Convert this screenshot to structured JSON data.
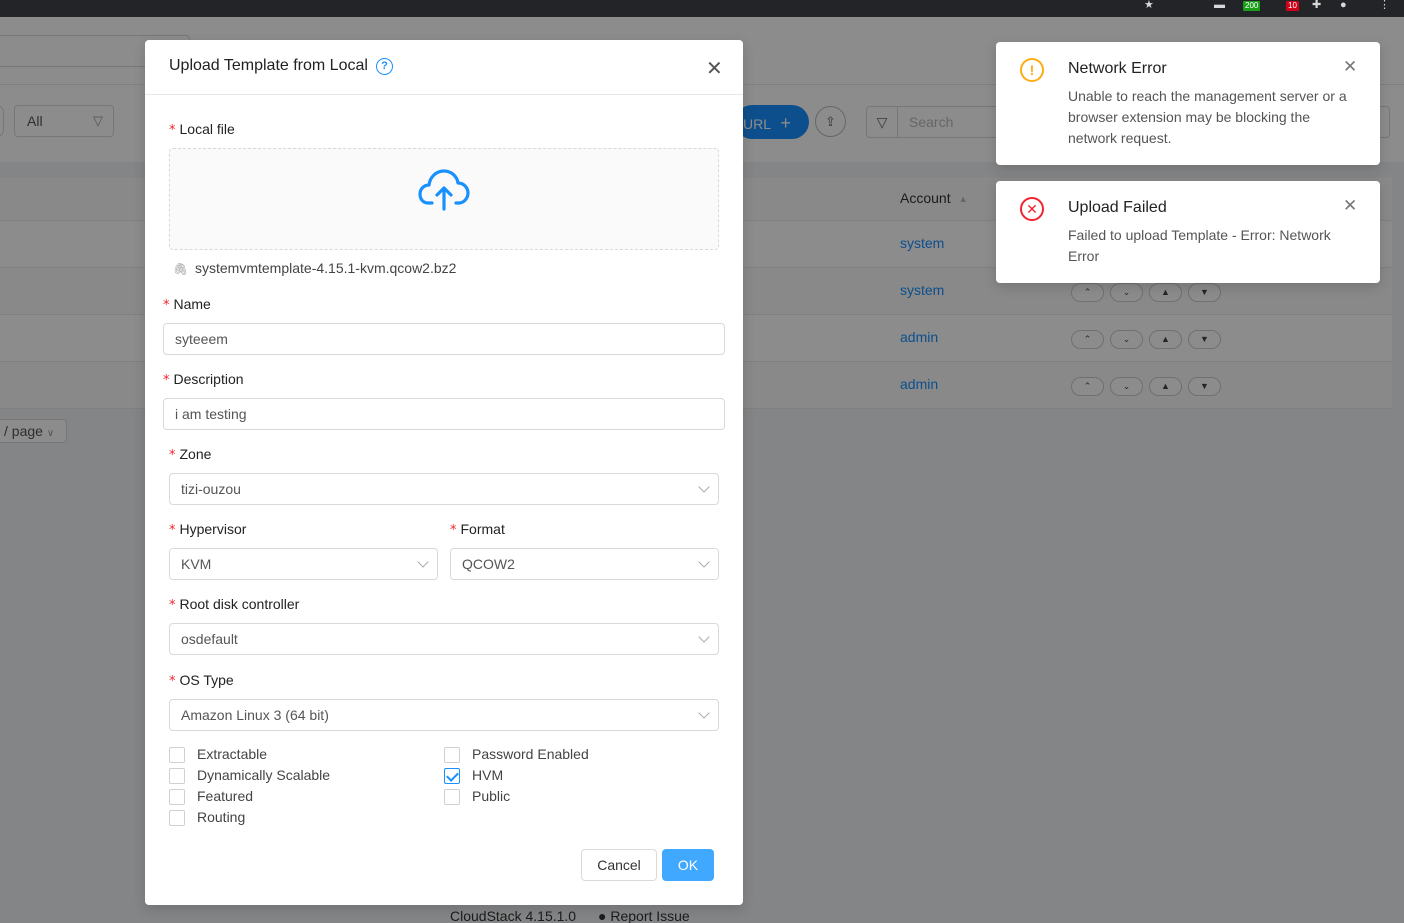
{
  "browser": {
    "badge_green": "200",
    "badge_red": "10"
  },
  "background": {
    "filter_value": "All",
    "url_button_label": "URL",
    "search_placeholder": "Search",
    "account_header": "Account",
    "rows": [
      {
        "account": "system"
      },
      {
        "account": "system"
      },
      {
        "account": "admin"
      },
      {
        "account": "admin"
      }
    ],
    "pager_label": "/ page",
    "footer_version": "CloudStack 4.15.1.0",
    "footer_report": "Report Issue"
  },
  "modal": {
    "title": "Upload Template from Local",
    "fields": {
      "local_file_label": "Local file",
      "file_name": "systemvmtemplate-4.15.1-kvm.qcow2.bz2",
      "name_label": "Name",
      "name_value": "syteeem",
      "description_label": "Description",
      "description_value": "i am testing",
      "zone_label": "Zone",
      "zone_value": "tizi-ouzou",
      "hypervisor_label": "Hypervisor",
      "hypervisor_value": "KVM",
      "format_label": "Format",
      "format_value": "QCOW2",
      "root_disk_label": "Root disk controller",
      "root_disk_value": "osdefault",
      "os_type_label": "OS Type",
      "os_type_value": "Amazon Linux 3 (64 bit)"
    },
    "checkboxes": [
      {
        "label": "Extractable",
        "checked": false
      },
      {
        "label": "Dynamically Scalable",
        "checked": false
      },
      {
        "label": "Featured",
        "checked": false
      },
      {
        "label": "Routing",
        "checked": false
      },
      {
        "label": "Password Enabled",
        "checked": false
      },
      {
        "label": "HVM",
        "checked": true
      },
      {
        "label": "Public",
        "checked": false
      }
    ],
    "cancel_label": "Cancel",
    "ok_label": "OK"
  },
  "notifications": [
    {
      "type": "warning",
      "title": "Network Error",
      "description": "Unable to reach the management server or a browser extension may be blocking the network request."
    },
    {
      "type": "error",
      "title": "Upload Failed",
      "description": "Failed to upload Template - Error: Network Error"
    }
  ],
  "colors": {
    "primary": "#1890ff",
    "ok_button": "#40a9ff",
    "required": "#f5222d",
    "warning": "#faad14",
    "error": "#f5222d"
  }
}
